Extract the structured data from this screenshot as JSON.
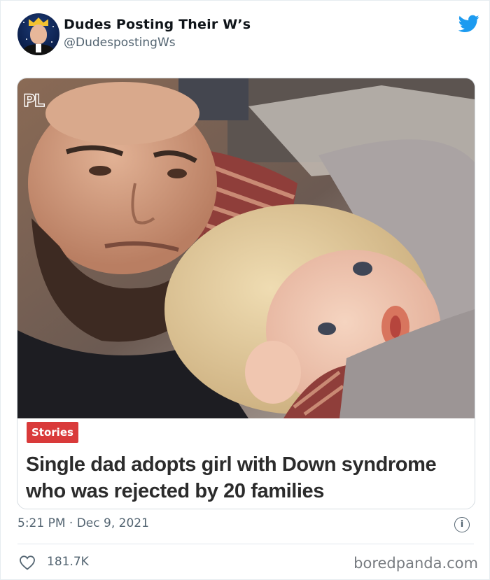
{
  "tweet": {
    "author_name": "Dudes Posting Their W’s",
    "author_handle": "@DudespostingWs",
    "timestamp": "5:21 PM · Dec 9, 2021",
    "likes": "181.7K"
  },
  "card": {
    "image_overlay_logo": "PL",
    "category_tag": "Stories",
    "headline": "Single dad adopts girl with Down syndrome who was rejected by 20 families"
  },
  "footer": {
    "watermark": "boredpanda.com"
  },
  "icons": {
    "brand": "twitter-bird-icon",
    "info": "info-icon",
    "like": "heart-icon"
  },
  "colors": {
    "twitter_blue": "#1d9bf0",
    "tag_red": "#d93a3a",
    "muted_text": "#536471"
  }
}
